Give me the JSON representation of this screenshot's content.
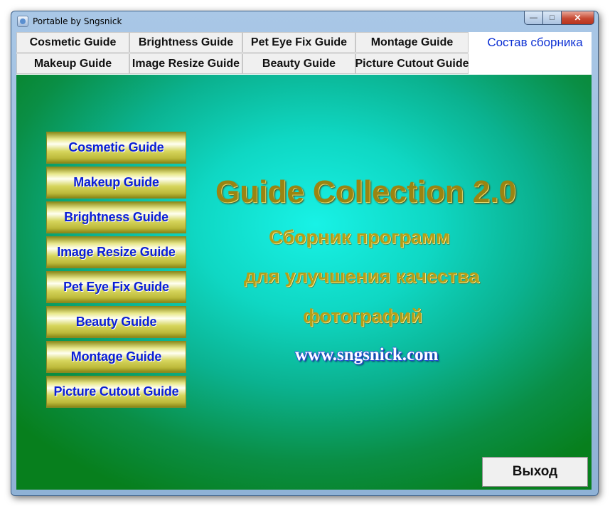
{
  "window": {
    "title": "Portable by Sngsnick",
    "controls": {
      "minimize": "—",
      "maximize": "□",
      "close": "✕"
    }
  },
  "tabs": {
    "row1": [
      "Cosmetic Guide",
      "Brightness Guide",
      "Pet Eye Fix Guide",
      "Montage Guide",
      "Состав сборника"
    ],
    "row2": [
      "Makeup Guide",
      "Image Resize Guide",
      "Beauty Guide",
      "Picture Cutout Guide"
    ],
    "active": "Состав сборника"
  },
  "sidebar": {
    "items": [
      "Cosmetic Guide",
      "Makeup Guide",
      "Brightness Guide",
      "Image Resize Guide",
      "Pet Eye Fix Guide",
      "Beauty Guide",
      "Montage Guide",
      "Picture Cutout Guide"
    ]
  },
  "main": {
    "title": "Guide Collection 2.0",
    "subtitle_line1": "Сборник программ",
    "subtitle_line2": "для улучшения качества",
    "subtitle_line3": "фотографий",
    "website": "www.sngsnick.com"
  },
  "footer": {
    "exit_label": "Выход"
  },
  "colors": {
    "link_blue": "#0b1fd6",
    "active_tab": "#0b2fd3",
    "gold": "#b59e18"
  }
}
